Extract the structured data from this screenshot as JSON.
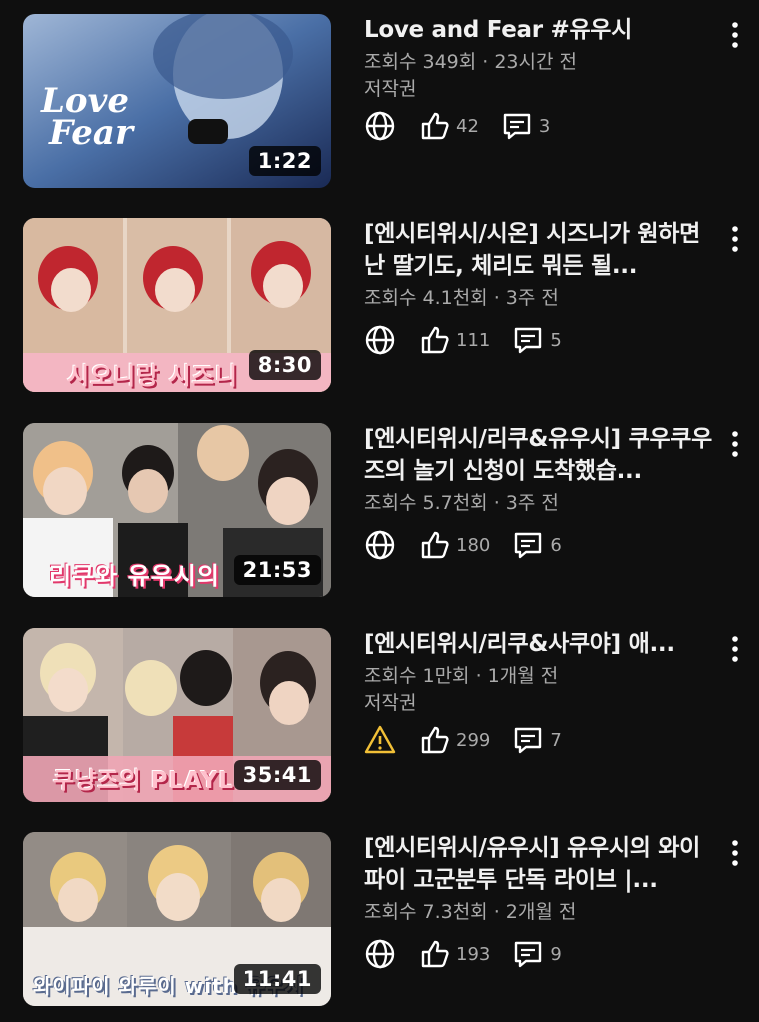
{
  "videos": [
    {
      "title": "Love and Fear #유우시",
      "meta": "조회수 349회 · 23시간 전",
      "sub": "저작권",
      "duration": "1:22",
      "likes": "42",
      "comments": "3",
      "status_icon": "globe-icon",
      "thumb_text": "Love Fear"
    },
    {
      "title": "[엔시티위시/시온] 시즈니가 원하면 난 딸기도, 체리도 뭐든 될...",
      "meta": "조회수 4.1천회 · 3주 전",
      "sub": "",
      "duration": "8:30",
      "likes": "111",
      "comments": "5",
      "status_icon": "globe-icon",
      "thumb_text": "시오니랑 시즈니"
    },
    {
      "title": "[엔시티위시/리쿠&유우시] 쿠우쿠우즈의 놀기 신청이 도착했습...",
      "meta": "조회수 5.7천회 · 3주 전",
      "sub": "",
      "duration": "21:53",
      "likes": "180",
      "comments": "6",
      "status_icon": "globe-icon",
      "thumb_text": "리쿠와 유우시의"
    },
    {
      "title": "[엔시티위시/리쿠&사쿠야] 애...",
      "meta": "조회수 1만회 · 1개월 전",
      "sub": "저작권",
      "duration": "35:41",
      "likes": "299",
      "comments": "7",
      "status_icon": "warning-icon",
      "thumb_text": "쿠냥즈의 PLAYL"
    },
    {
      "title": "[엔시티위시/유우시] 유우시의 와이파이 고군분투 단독 라이브 |...",
      "meta": "조회수 7.3천회 · 2개월 전",
      "sub": "",
      "duration": "11:41",
      "likes": "193",
      "comments": "9",
      "status_icon": "globe-icon",
      "thumb_text": "와이파이 와루이 with 유우시"
    }
  ],
  "colors": {
    "background": "#0f0f0f",
    "title": "#f1f1f1",
    "meta": "#aaaaaa",
    "warning": "#f2c037"
  }
}
